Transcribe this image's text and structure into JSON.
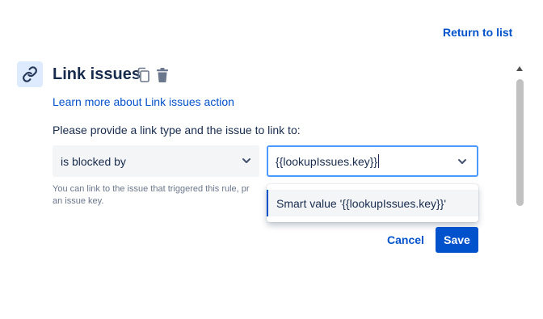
{
  "header": {
    "return_label": "Return to list"
  },
  "action": {
    "icon": "link-icon",
    "title": "Link issues",
    "learn_more": "Learn more about Link issues action",
    "prompt": "Please provide a link type and the issue to link to:"
  },
  "link_type": {
    "selected": "is blocked by",
    "icon": "chevron-down-icon"
  },
  "issue_input": {
    "value": "{{lookupIssues.key}}",
    "icon": "chevron-down-icon"
  },
  "helper_text": "You can link to the issue that triggered this rule, p… an issue key.",
  "helper_lines": [
    "You can link to the issue that triggered this rule, pr",
    "an issue key."
  ],
  "dropdown": {
    "options": [
      "Smart value '{{lookupIssues.key}}'"
    ]
  },
  "buttons": {
    "cancel": "Cancel",
    "save": "Save"
  },
  "colors": {
    "accent": "#0052cc",
    "focus": "#4c9aff",
    "icon_bg": "#deebff"
  }
}
